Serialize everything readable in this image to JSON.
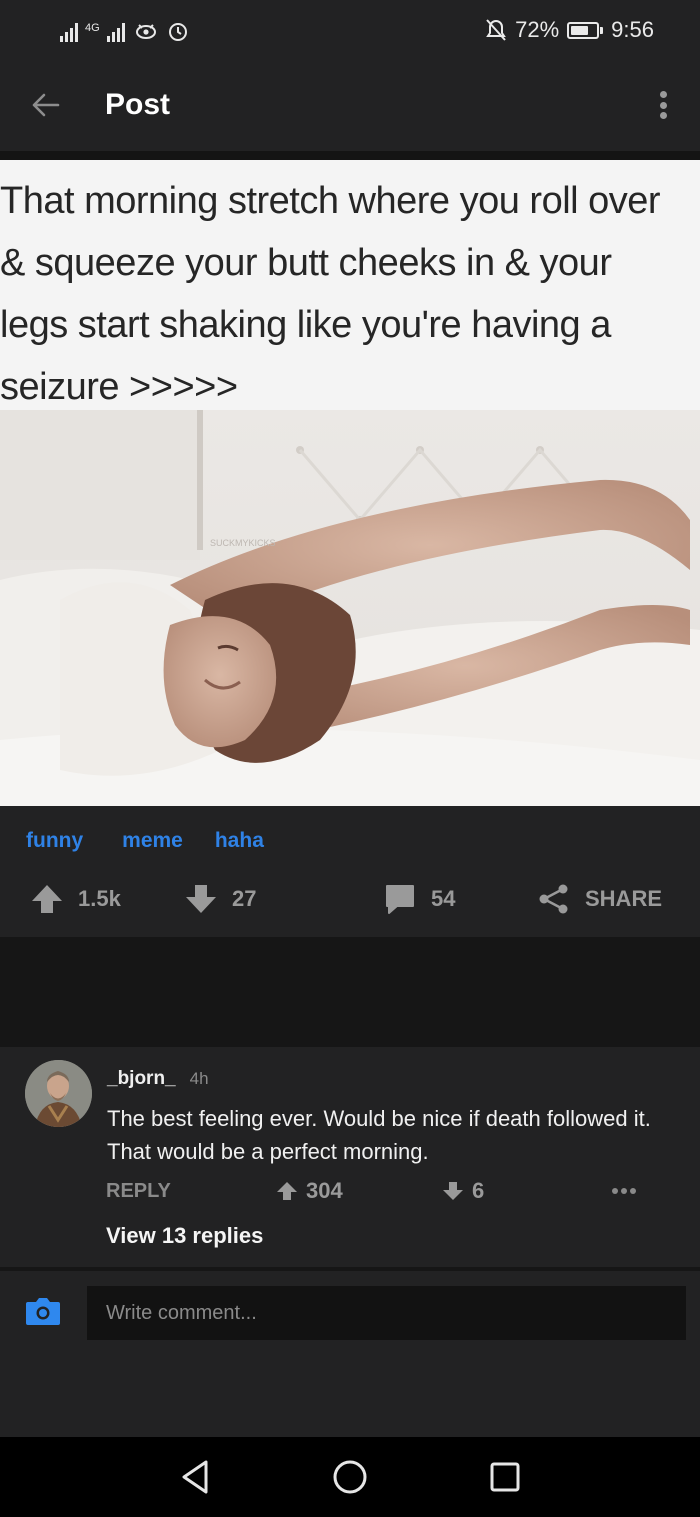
{
  "status_bar": {
    "network_label": "4G",
    "battery_percent": "72%",
    "battery_level": 0.72,
    "time": "9:56"
  },
  "header": {
    "title": "Post"
  },
  "post": {
    "caption_lines": [
      "That morning stretch where you roll over",
      "& squeeze your butt cheeks in & your",
      "legs start shaking like you're having a",
      "seizure >>>>>"
    ],
    "watermark": "SUCKMYKICKS",
    "tags": [
      "funny",
      "meme",
      "haha"
    ],
    "upvotes": "1.5k",
    "downvotes": "27",
    "comments": "54",
    "share_label": "SHARE"
  },
  "comment": {
    "username": "_bjorn_",
    "time": "4h",
    "text": "The best feeling ever. Would be nice if death followed it. That would be a perfect morning.",
    "reply_label": "REPLY",
    "upvotes": "304",
    "downvotes": "6",
    "view_replies_label": "View 13 replies"
  },
  "composer": {
    "placeholder": "Write comment..."
  },
  "colors": {
    "background": "#222223",
    "accent_blue": "#2f82e6",
    "muted": "#9a9a9a"
  },
  "icons": [
    "signal-icon",
    "eye-icon",
    "alarm-icon",
    "mute-icon",
    "battery-icon",
    "back-arrow-icon",
    "more-vertical-icon",
    "upvote-icon",
    "downvote-icon",
    "comment-icon",
    "share-icon",
    "camera-icon",
    "nav-back-icon",
    "nav-home-icon",
    "nav-recents-icon"
  ]
}
